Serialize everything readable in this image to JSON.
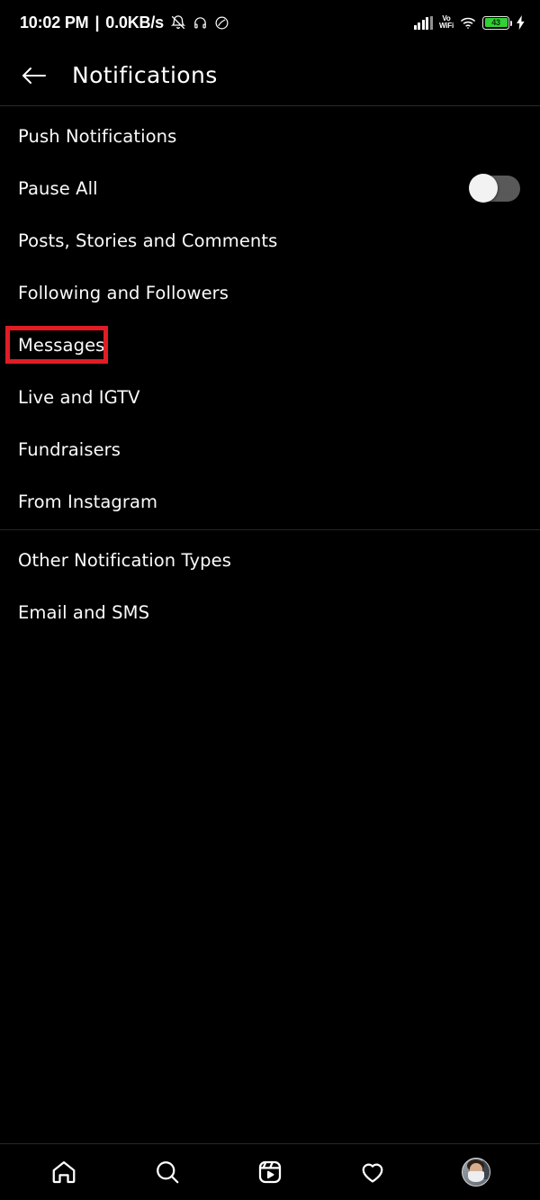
{
  "status_bar": {
    "time": "10:02 PM",
    "separator": "|",
    "network_speed": "0.0KB/s",
    "left_icons": [
      "bell-muted-icon",
      "headphones-icon",
      "dnd-icon"
    ],
    "signal_label": "signal-bars-icon",
    "vowifi_line1": "Vo",
    "vowifi_line2": "WiFi",
    "wifi_label": "wifi-icon",
    "battery_percent": "43",
    "battery_color": "#2fd032",
    "charging": true
  },
  "header": {
    "back_label": "back-arrow",
    "title": "Notifications"
  },
  "push_section": {
    "items": [
      {
        "label": "Push Notifications",
        "type": "header",
        "highlighted": false
      },
      {
        "label": "Pause All",
        "type": "toggle",
        "toggle_on": false,
        "highlighted": false
      },
      {
        "label": "Posts, Stories and Comments",
        "type": "link",
        "highlighted": false
      },
      {
        "label": "Following and Followers",
        "type": "link",
        "highlighted": false
      },
      {
        "label": "Messages",
        "type": "link",
        "highlighted": true
      },
      {
        "label": "Live and IGTV",
        "type": "link",
        "highlighted": false
      },
      {
        "label": "Fundraisers",
        "type": "link",
        "highlighted": false
      },
      {
        "label": "From Instagram",
        "type": "link",
        "highlighted": false
      }
    ]
  },
  "other_section": {
    "items": [
      {
        "label": "Other Notification Types",
        "type": "header",
        "highlighted": false
      },
      {
        "label": "Email and SMS",
        "type": "link",
        "highlighted": false
      }
    ]
  },
  "annotation": {
    "target": "Messages",
    "box_color": "#e01b24"
  },
  "bottom_nav": {
    "items": [
      {
        "name": "home-icon",
        "label": "Home"
      },
      {
        "name": "search-icon",
        "label": "Search"
      },
      {
        "name": "reels-icon",
        "label": "Reels"
      },
      {
        "name": "heart-icon",
        "label": "Activity"
      },
      {
        "name": "profile-avatar",
        "label": "Profile"
      }
    ]
  }
}
